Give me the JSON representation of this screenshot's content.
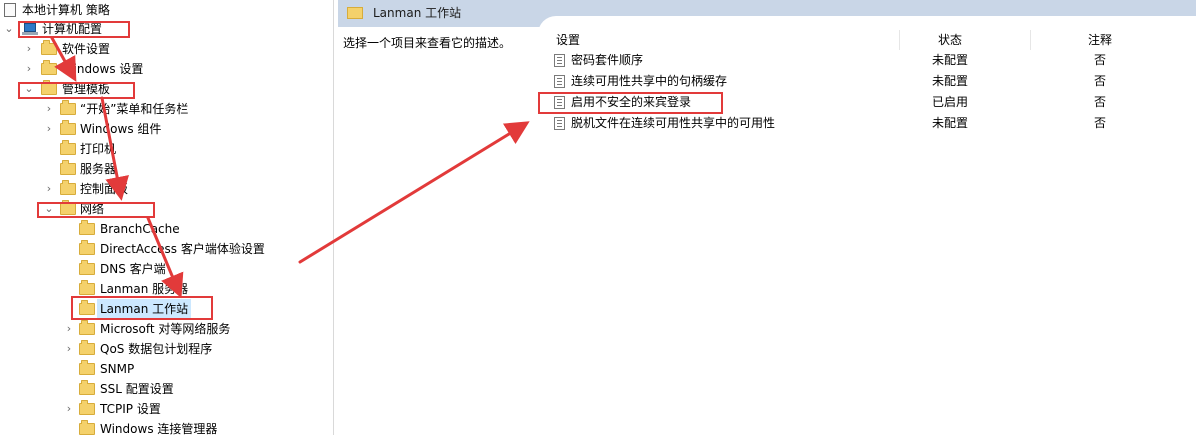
{
  "tree": {
    "root": "本地计算机 策略",
    "computer_config": "计算机配置",
    "software_settings": "软件设置",
    "windows_settings": "Windows 设置",
    "admin_templates": "管理模板",
    "start_menu": "“开始”菜单和任务栏",
    "windows_components": "Windows 组件",
    "printers": "打印机",
    "server": "服务器",
    "control_panel": "控制面板",
    "network": "网络",
    "network_children": [
      "BranchCache",
      "DirectAccess 客户端体验设置",
      "DNS 客户端",
      "Lanman 服务器",
      "Lanman 工作站",
      "Microsoft 对等网络服务",
      "QoS 数据包计划程序",
      "SNMP",
      "SSL 配置设置",
      "TCPIP 设置",
      "Windows 连接管理器"
    ]
  },
  "panel": {
    "title": "Lanman 工作站",
    "description": "选择一个项目来查看它的描述。",
    "columns": {
      "setting": "设置",
      "state": "状态",
      "note": "注释"
    },
    "rows": [
      {
        "name": "密码套件顺序",
        "state": "未配置",
        "note": "否"
      },
      {
        "name": "连续可用性共享中的句柄缓存",
        "state": "未配置",
        "note": "否"
      },
      {
        "name": "启用不安全的来宾登录",
        "state": "已启用",
        "note": "否"
      },
      {
        "name": "脱机文件在连续可用性共享中的可用性",
        "state": "未配置",
        "note": "否"
      }
    ]
  },
  "colors": {
    "annotation": "#e23a3a",
    "header": "#c9d6e7",
    "selection": "#cce8ff"
  }
}
